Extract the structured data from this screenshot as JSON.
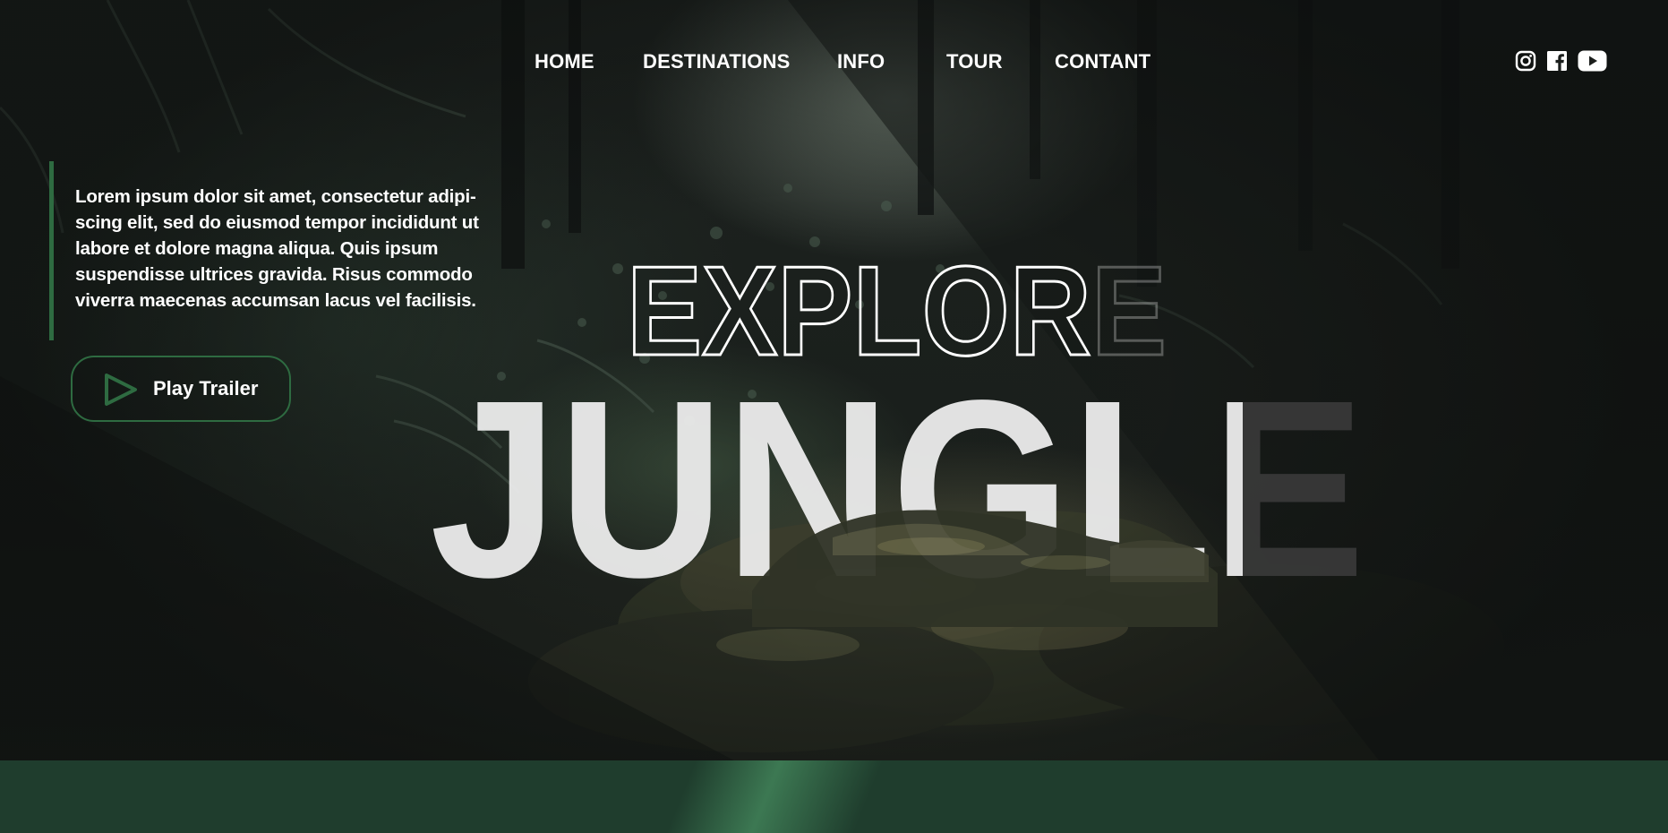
{
  "nav": {
    "items": [
      {
        "label": "HOME"
      },
      {
        "label": "DESTINATIONS"
      },
      {
        "label": "INFO"
      },
      {
        "label": "TOUR"
      },
      {
        "label": "CONTANT"
      }
    ]
  },
  "social": {
    "icons": [
      "instagram-icon",
      "facebook-icon",
      "youtube-icon"
    ]
  },
  "intro": {
    "text": "Lorem ipsum dolor sit amet, consectetur adipi-scing elit, sed do eiusmod tempor incididunt ut labore et dolore magna aliqua. Quis ipsum suspendisse ultrices gravida. Risus commodo viverra maecenas accumsan lacus vel facilisis."
  },
  "trailer": {
    "label": "Play Trailer",
    "icon": "play-icon"
  },
  "headline": {
    "line1": "EXPLORE",
    "line2": "JUNGLE"
  },
  "colors": {
    "accent": "#2e6b41",
    "band": "#1f3d2d",
    "text": "#ffffff",
    "headline_fill": "#eeeeee"
  }
}
